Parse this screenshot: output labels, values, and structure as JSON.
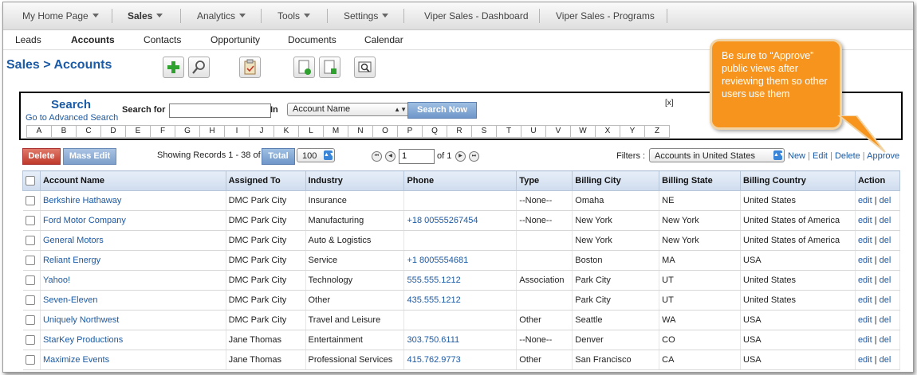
{
  "top_nav": {
    "items": [
      {
        "label": "My Home Page",
        "dropdown": true
      },
      {
        "label": "Sales",
        "dropdown": true,
        "active": true
      },
      {
        "label": "Analytics",
        "dropdown": true
      },
      {
        "label": "Tools",
        "dropdown": true
      },
      {
        "label": "Settings",
        "dropdown": true
      },
      {
        "label": "Viper Sales - Dashboard",
        "dropdown": false
      },
      {
        "label": "Viper Sales - Programs",
        "dropdown": false
      }
    ]
  },
  "sub_nav": {
    "items": [
      {
        "label": "Leads"
      },
      {
        "label": "Accounts",
        "active": true
      },
      {
        "label": "Contacts"
      },
      {
        "label": "Opportunity"
      },
      {
        "label": "Documents"
      },
      {
        "label": "Calendar"
      }
    ]
  },
  "page": {
    "title": "Sales > Accounts",
    "toolbar_icons": [
      "add-icon",
      "search-icon",
      "clipboard-icon",
      "import-icon",
      "export-icon",
      "find-duplicates-icon"
    ]
  },
  "search": {
    "title": "Search",
    "advanced_link": "Go to Advanced Search",
    "search_for_label": "Search for",
    "search_value": "",
    "in_label": "In",
    "field_select": "Account Name",
    "button": "Search Now",
    "close": "[x]",
    "alphabet": [
      "A",
      "B",
      "C",
      "D",
      "E",
      "F",
      "G",
      "H",
      "I",
      "J",
      "K",
      "L",
      "M",
      "N",
      "O",
      "P",
      "Q",
      "R",
      "S",
      "T",
      "U",
      "V",
      "W",
      "X",
      "Y",
      "Z"
    ]
  },
  "callout": {
    "text": "Be sure to “Approve” public views after reviewing them so other users use them",
    "color": "#f7941d"
  },
  "list_controls": {
    "delete": "Delete",
    "mass_edit": "Mass Edit",
    "showing": "Showing Records 1 - 38 of",
    "total": "Total",
    "per_page": "100",
    "page_number": "1",
    "of_pages": "of 1",
    "filters_label": "Filters :",
    "filter_select": "Accounts in United States",
    "filter_links": {
      "new": "New",
      "edit": "Edit",
      "delete": "Delete",
      "approve": "Approve"
    }
  },
  "table": {
    "columns": [
      "Account Name",
      "Assigned To",
      "Industry",
      "Phone",
      "Type",
      "Billing City",
      "Billing State",
      "Billing Country",
      "Action"
    ],
    "rows": [
      {
        "name": "Berkshire Hathaway",
        "assigned": "DMC Park City",
        "industry": "Insurance",
        "phone": "",
        "type": "--None--",
        "city": "Omaha",
        "state": "NE",
        "country": "United States"
      },
      {
        "name": "Ford Motor Company",
        "assigned": "DMC Park City",
        "industry": "Manufacturing",
        "phone": "+18 00555267454",
        "type": "--None--",
        "city": "New York",
        "state": "New York",
        "country": "United States of America"
      },
      {
        "name": "General Motors",
        "assigned": "DMC Park City",
        "industry": "Auto & Logistics",
        "phone": "",
        "type": "",
        "city": "New York",
        "state": "New York",
        "country": "United States of America"
      },
      {
        "name": "Reliant Energy",
        "assigned": "DMC Park City",
        "industry": "Service",
        "phone": "+1 8005554681",
        "type": "",
        "city": "Boston",
        "state": "MA",
        "country": "USA"
      },
      {
        "name": "Yahoo!",
        "assigned": "DMC Park City",
        "industry": "Technology",
        "phone": "555.555.1212",
        "type": "Association",
        "city": "Park City",
        "state": "UT",
        "country": "United States"
      },
      {
        "name": "Seven-Eleven",
        "assigned": "DMC Park City",
        "industry": "Other",
        "phone": "435.555.1212",
        "type": "",
        "city": "Park City",
        "state": "UT",
        "country": "United States"
      },
      {
        "name": "Uniquely Northwest",
        "assigned": "DMC Park City",
        "industry": "Travel and Leisure",
        "phone": "",
        "type": "Other",
        "city": "Seattle",
        "state": "WA",
        "country": "USA"
      },
      {
        "name": "StarKey Productions",
        "assigned": "Jane Thomas",
        "industry": "Entertainment",
        "phone": "303.750.6111",
        "type": "--None--",
        "city": "Denver",
        "state": "CO",
        "country": "USA"
      },
      {
        "name": "Maximize Events",
        "assigned": "Jane Thomas",
        "industry": "Professional Services",
        "phone": "415.762.9773",
        "type": "Other",
        "city": "San Francisco",
        "state": "CA",
        "country": "USA"
      }
    ],
    "action_edit": "edit",
    "action_sep": "|",
    "action_del": "del"
  }
}
